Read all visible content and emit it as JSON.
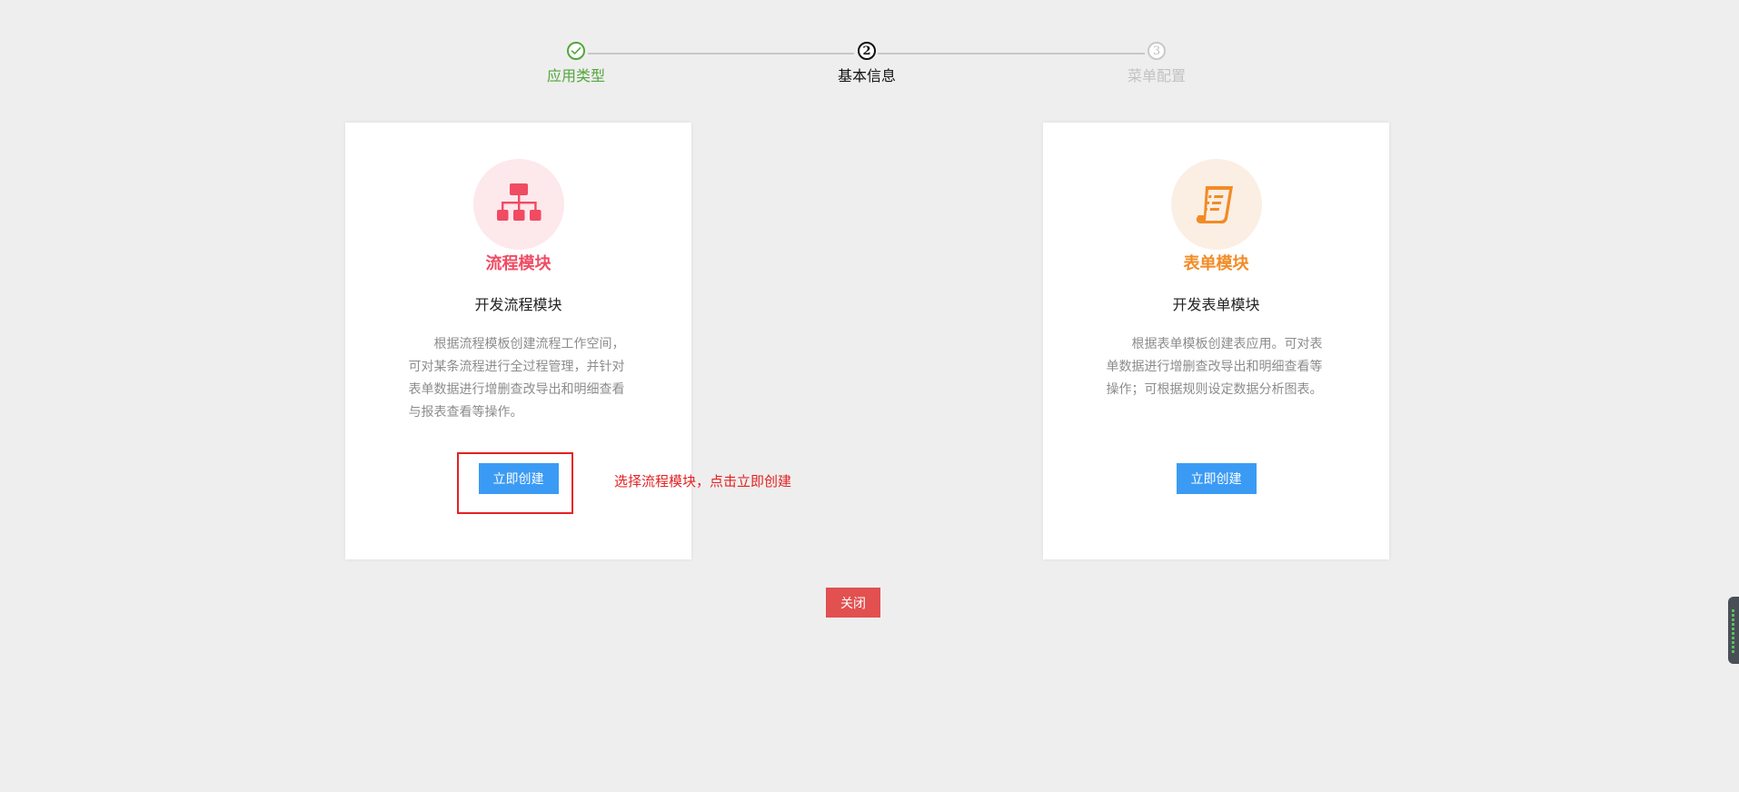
{
  "stepper": {
    "steps": [
      {
        "label": "应用类型",
        "state": "done",
        "marker": ""
      },
      {
        "label": "基本信息",
        "state": "active",
        "marker": "2"
      },
      {
        "label": "菜单配置",
        "state": "todo",
        "marker": "3"
      }
    ]
  },
  "cards": [
    {
      "icon": "flowchart-icon",
      "icon_bg": "#fde8ec",
      "accent": "#f04b62",
      "title": "流程模块",
      "subtitle": "开发流程模块",
      "description": "根据流程模板创建流程工作空间，可对某条流程进行全过程管理，并针对表单数据进行增删查改导出和明细查看与报表查看等操作。",
      "button_label": "立即创建"
    },
    {
      "icon": "form-document-icon",
      "icon_bg": "#fbeee3",
      "accent": "#f28b25",
      "title": "表单模块",
      "subtitle": "开发表单模块",
      "description": "根据表单模板创建表应用。可对表单数据进行增删查改导出和明细查看等操作；可根据规则设定数据分析图表。",
      "button_label": "立即创建"
    }
  ],
  "annotation": {
    "text": "选择流程模块，点击立即创建",
    "color": "#e52121"
  },
  "footer": {
    "close_label": "关闭"
  },
  "colors": {
    "background": "#eeeeee",
    "primary_button": "#3b9bf4",
    "close_button": "#e25050",
    "step_done": "#52a73a"
  }
}
